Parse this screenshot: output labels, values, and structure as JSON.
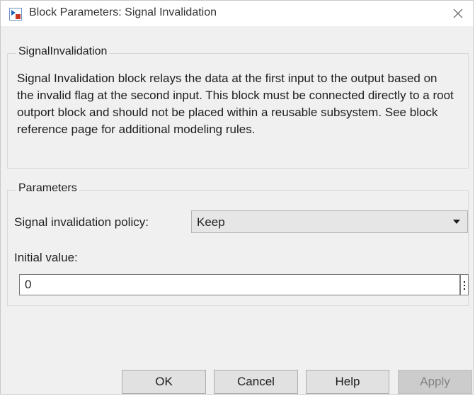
{
  "window": {
    "title": "Block Parameters: Signal Invalidation"
  },
  "icons": {
    "title_icon": "block-parameters-icon",
    "close": "close-icon",
    "dropdown": "chevron-down-icon",
    "more": "vertical-ellipsis-icon"
  },
  "description_group": {
    "legend": "SignalInvalidation",
    "text": "Signal Invalidation block relays the data at the first input to the output based on the invalid flag at the second input. This block must be connected directly to a root outport block and should not be placed within a reusable subsystem. See block reference page for additional modeling rules."
  },
  "parameters_group": {
    "legend": "Parameters",
    "policy_label": "Signal invalidation policy:",
    "policy_value": "Keep",
    "initial_value_label": "Initial value:",
    "initial_value": "0"
  },
  "buttons": {
    "ok": "OK",
    "cancel": "Cancel",
    "help": "Help",
    "apply": "Apply"
  },
  "colors": {
    "title_icon_blue": "#1f62b5",
    "title_icon_red": "#c8361f",
    "button_face": "#e1e1e1",
    "disabled_text": "#838383"
  }
}
